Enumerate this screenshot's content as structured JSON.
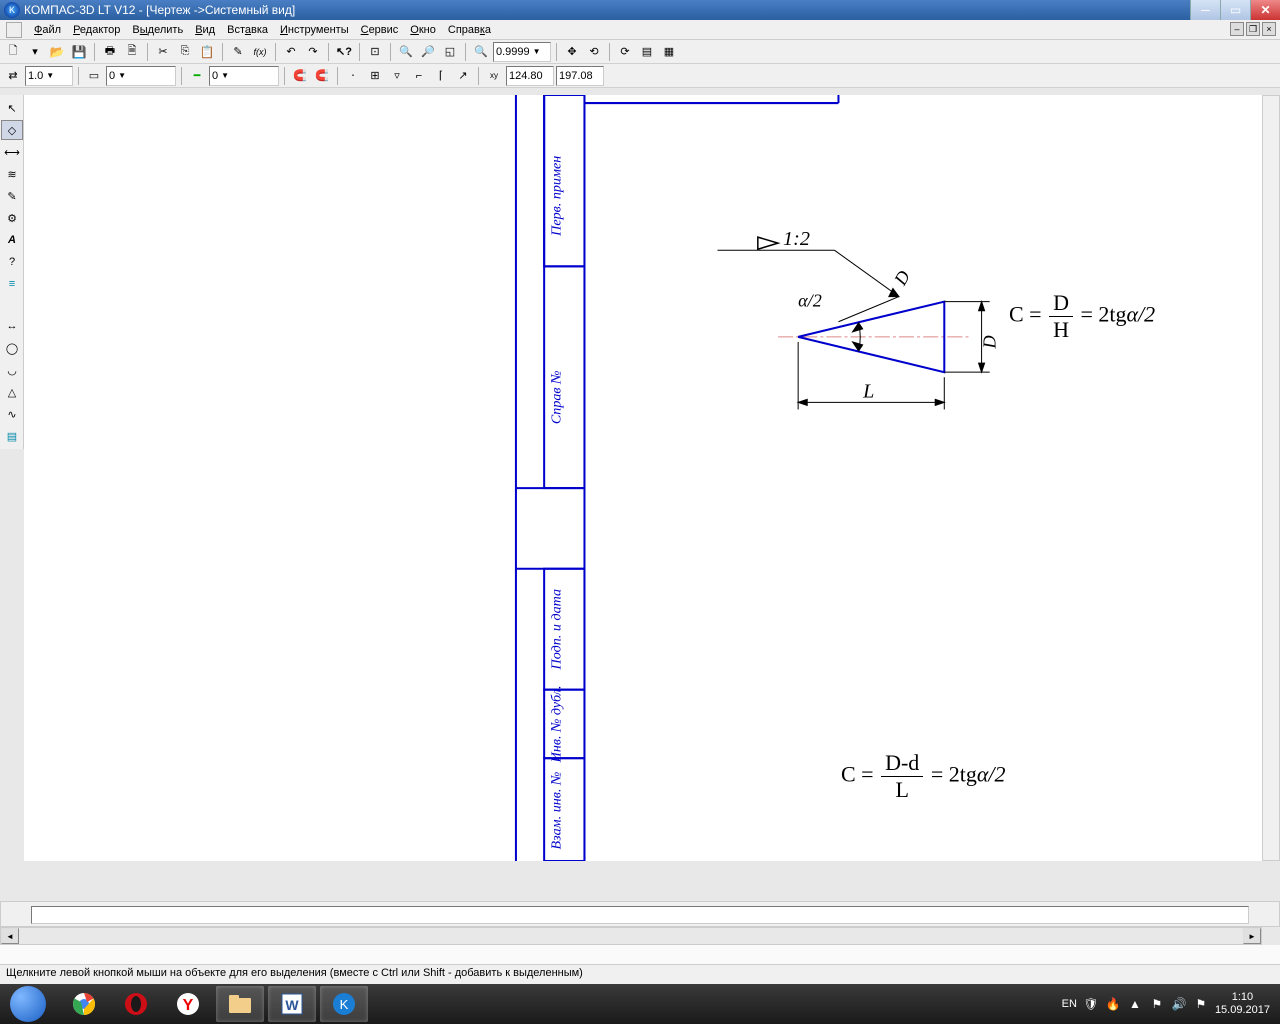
{
  "title": "КОМПАС-3D LT V12 - [Чертеж ->Системный вид]",
  "menu": {
    "file": "Файл",
    "edit": "Редактор",
    "select": "Выделить",
    "view": "Вид",
    "insert": "Вставка",
    "tools": "Инструменты",
    "service": "Сервис",
    "window": "Окно",
    "help": "Справка"
  },
  "toolbar2": {
    "zoom_value": "0.9999"
  },
  "toolbar3": {
    "combo1": "1.0",
    "combo2": "0",
    "combo3": "0",
    "coord_x": "124.80",
    "coord_y": "197.08"
  },
  "drawing": {
    "angle_label": "α/2",
    "taper_label": "1:2",
    "dim_D1": "D",
    "dim_D2": "D",
    "dim_L": "L",
    "side_label1": "Перв. примен",
    "side_label2": "Справ №",
    "side_label3": "Подп. и дата",
    "side_label4": "Инв. № дубл.",
    "side_label5": "Взам. инв. №"
  },
  "formula1": {
    "lhs": "C =",
    "num1": "D",
    "den1": "H",
    "mid": "= 2tg",
    "ang": "α/2"
  },
  "formula2": {
    "lhs": "C =",
    "num1": "D-d",
    "den1": "L",
    "mid": "= 2tg",
    "ang": "α/2"
  },
  "statusbar": "Щелкните левой кнопкой мыши на объекте для его выделения (вместе с Ctrl или Shift - добавить к выделенным)",
  "tray": {
    "lang": "EN",
    "time": "1:10",
    "date": "15.09.2017"
  }
}
